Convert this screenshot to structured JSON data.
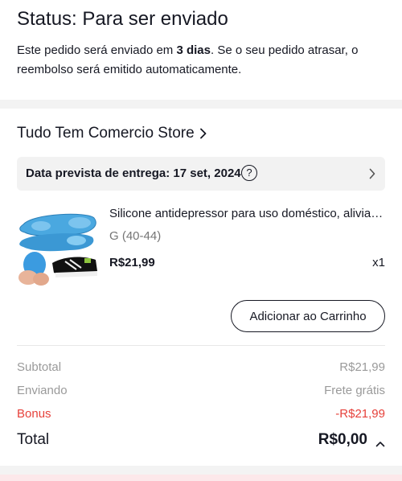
{
  "status": {
    "title": "Status: Para ser enviado",
    "desc_prefix": "Este pedido será enviado em ",
    "desc_days": "3 dias",
    "desc_suffix": ". Se o seu pedido atrasar, o reembolso será emitido automaticamente."
  },
  "store": {
    "name": "Tudo Tem Comercio Store",
    "chevron_icon": "chevron-right-icon"
  },
  "delivery": {
    "text": "Data prevista de entrega: 17 set, 2024",
    "help_icon": "help-circle-icon",
    "help_glyph": "?",
    "chevron_icon": "chevron-right-icon"
  },
  "product": {
    "name": "Silicone antidepressor para uso doméstico, alivia a dor nos pés",
    "variant": "G (40-44)",
    "price": "R$21,99",
    "quantity": "x1",
    "image": "insole-product-image"
  },
  "actions": {
    "add_to_cart": "Adicionar ao Carrinho"
  },
  "summary": {
    "subtotal_label": "Subtotal",
    "subtotal_value": "R$21,99",
    "shipping_label": "Enviando",
    "shipping_value": "Frete grátis",
    "bonus_label": "Bonus",
    "bonus_value": "-R$21,99",
    "total_label": "Total",
    "total_value": "R$0,00",
    "total_icon": "chevron-up-icon"
  },
  "colors": {
    "text": "#161823",
    "muted": "#9a9a9a",
    "bonus": "#e6413b",
    "section_bg": "#f3f3f3",
    "insole_blue": "#4aa8e0"
  }
}
